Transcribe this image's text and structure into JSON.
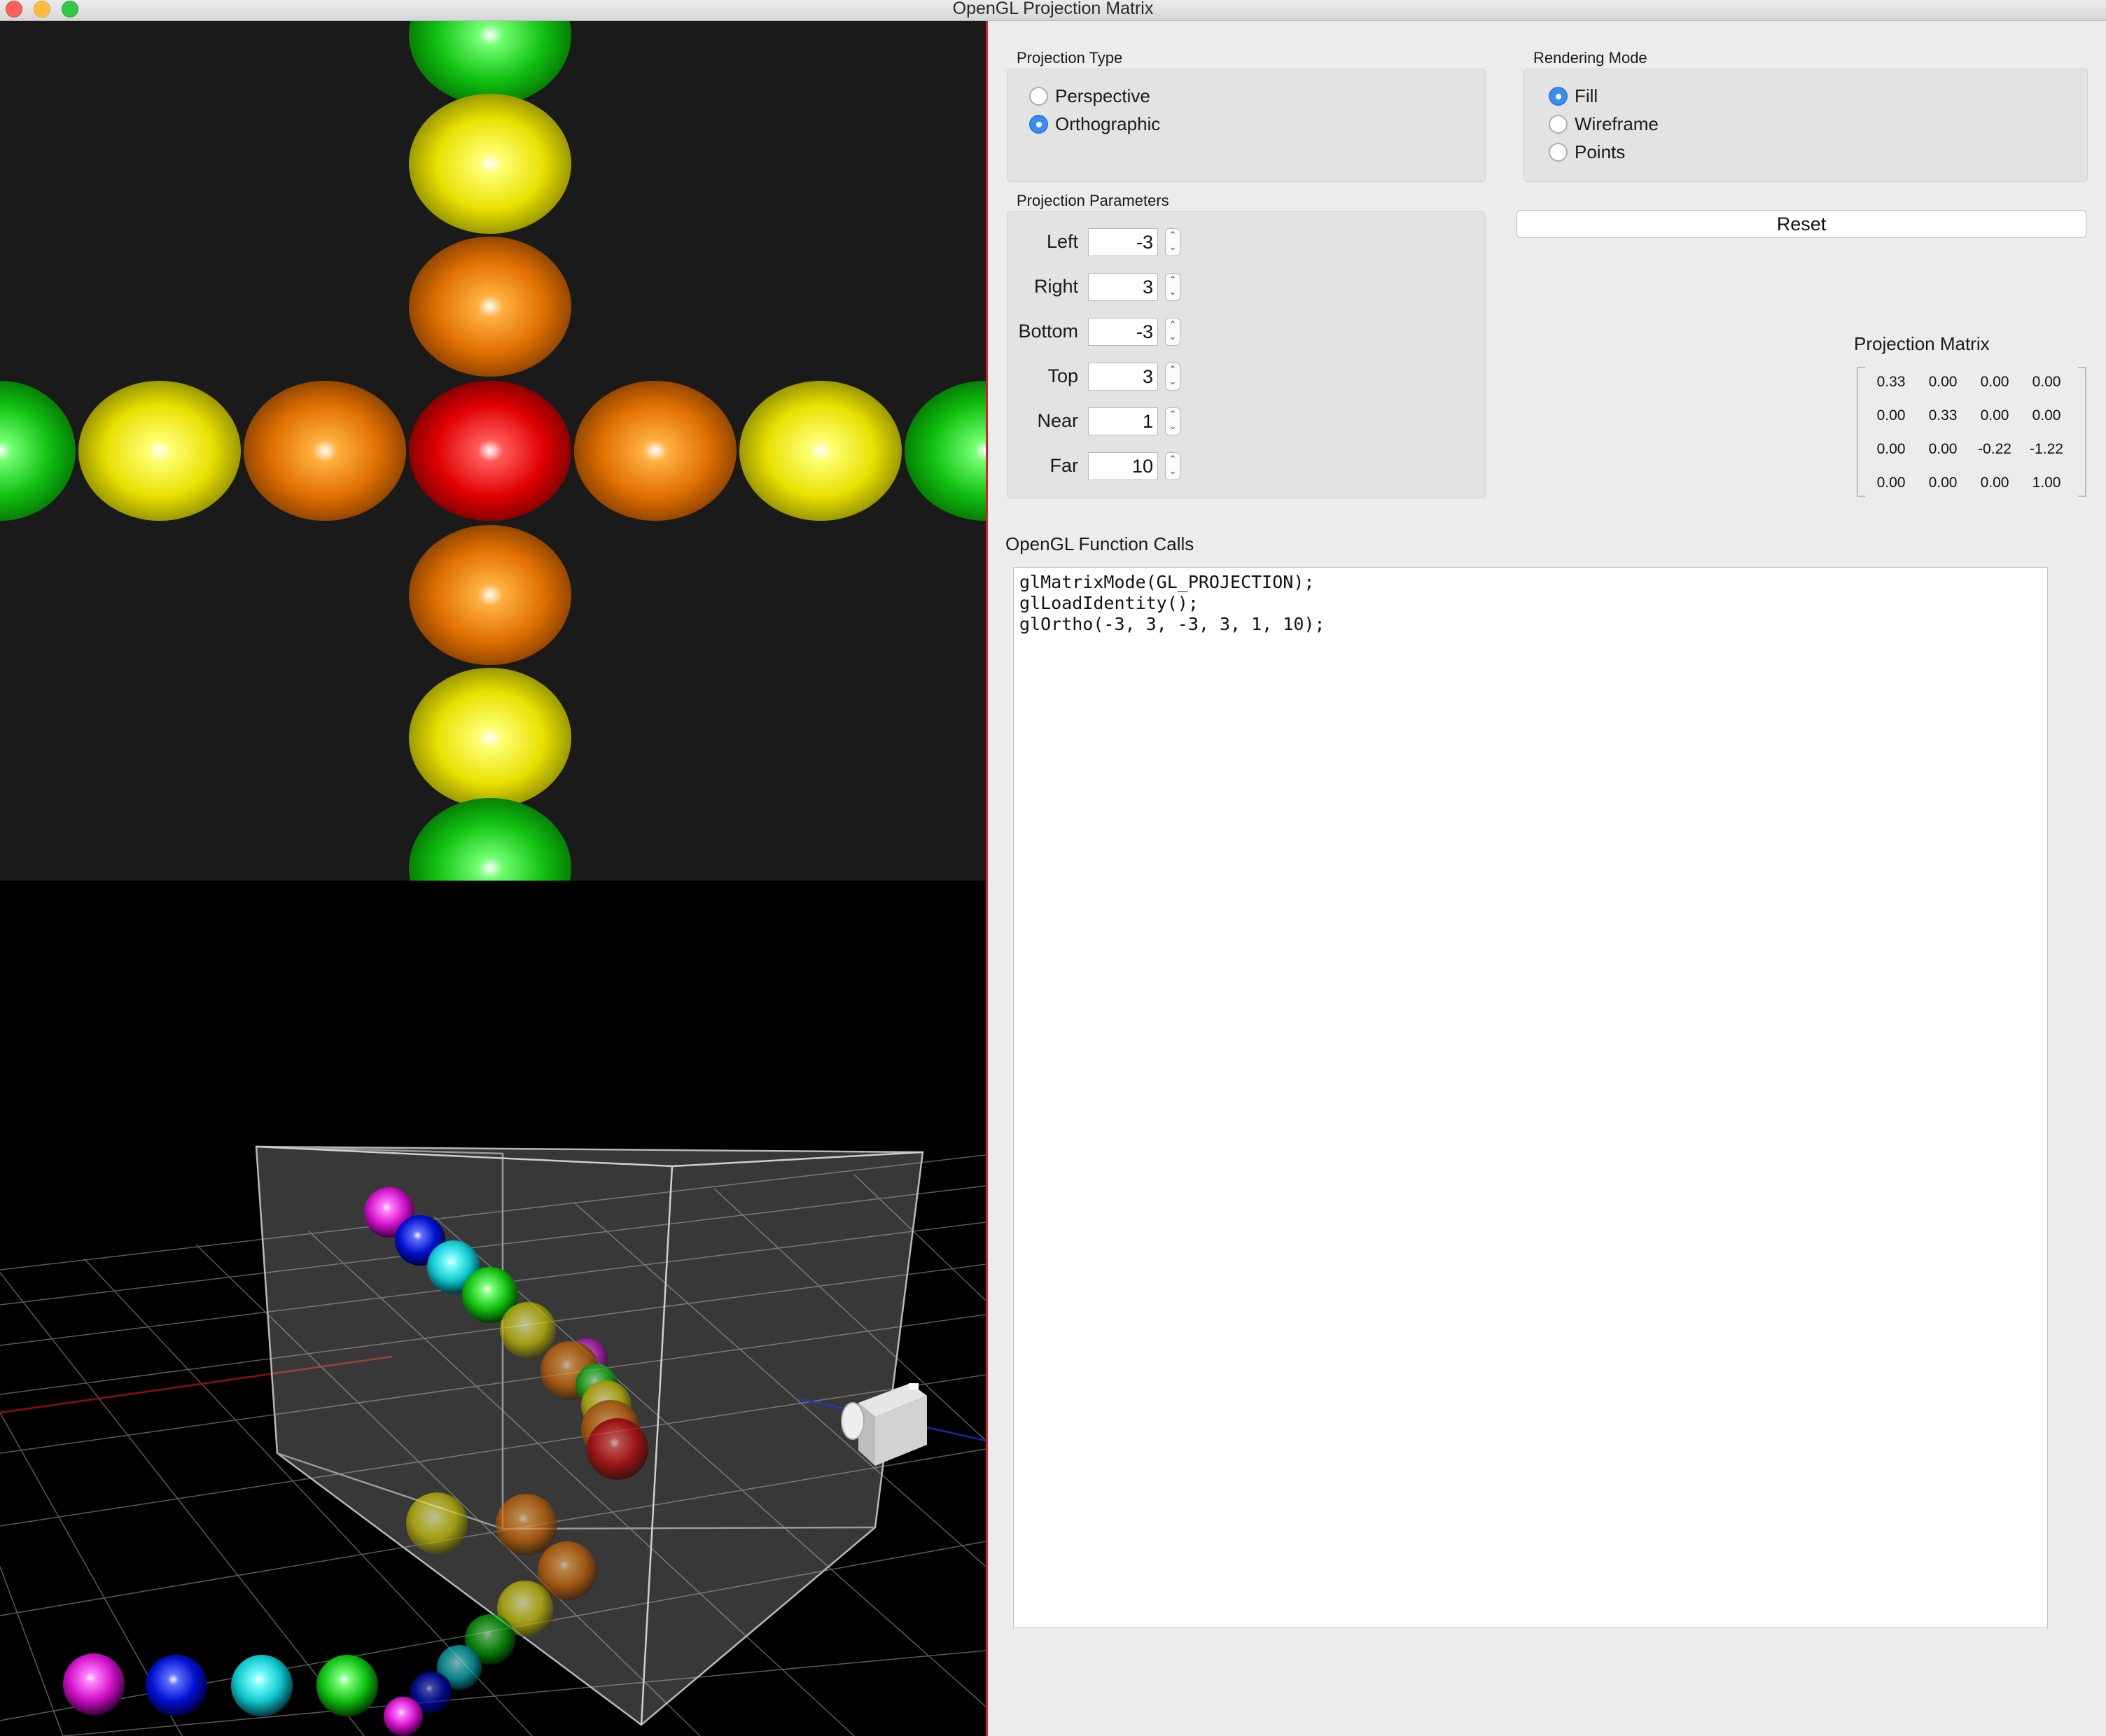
{
  "window": {
    "title": "OpenGL Projection Matrix"
  },
  "projection_type": {
    "title": "Projection Type",
    "options": [
      "Perspective",
      "Orthographic"
    ],
    "selected": "Orthographic"
  },
  "rendering_mode": {
    "title": "Rendering Mode",
    "options": [
      "Fill",
      "Wireframe",
      "Points"
    ],
    "selected": "Fill"
  },
  "projection_parameters": {
    "title": "Projection Parameters",
    "params": [
      {
        "label": "Left",
        "value": "-3"
      },
      {
        "label": "Right",
        "value": "3"
      },
      {
        "label": "Bottom",
        "value": "-3"
      },
      {
        "label": "Top",
        "value": "3"
      },
      {
        "label": "Near",
        "value": "1"
      },
      {
        "label": "Far",
        "value": "10"
      }
    ]
  },
  "reset_label": "Reset",
  "projection_matrix": {
    "title": "Projection Matrix",
    "rows": [
      [
        "0.33",
        "0.00",
        "0.00",
        "0.00"
      ],
      [
        "0.00",
        "0.33",
        "0.00",
        "0.00"
      ],
      [
        "0.00",
        "0.00",
        "-0.22",
        "-1.22"
      ],
      [
        "0.00",
        "0.00",
        "0.00",
        "1.00"
      ]
    ]
  },
  "function_calls": {
    "title": "OpenGL Function Calls",
    "lines": [
      "glMatrixMode(GL_PROJECTION);",
      "glLoadIdentity();",
      "glOrtho(-3, 3, -3, 3, 1, 10);"
    ]
  },
  "colors": {
    "accent": "#3d8ef2",
    "viewport_bg": "#1a1a1a",
    "scene_bg": "#000000",
    "divider": "#d8212a",
    "sphere_red": "#ff2a2a",
    "sphere_orange": "#ff8a1a",
    "sphere_yellow": "#ffff22",
    "sphere_green": "#20e020",
    "sphere_cyan": "#20e8f0",
    "sphere_blue": "#2030ff",
    "sphere_magenta": "#ff20e0"
  }
}
